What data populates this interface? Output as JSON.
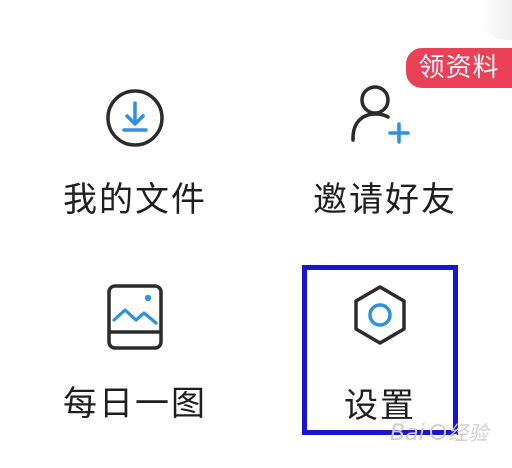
{
  "menu": {
    "items": [
      {
        "label": "我的文件",
        "icon": "download-circle-icon"
      },
      {
        "label": "邀请好友",
        "icon": "add-user-icon"
      },
      {
        "label": "每日一图",
        "icon": "picture-icon"
      },
      {
        "label": "设置",
        "icon": "settings-hexagon-icon"
      }
    ],
    "badge": "领资料"
  },
  "colors": {
    "accent_blue": "#2f8fe0",
    "icon_stroke": "#2b2b2b",
    "badge_bg": "#ea4158",
    "highlight_box": "#1515d6"
  }
}
